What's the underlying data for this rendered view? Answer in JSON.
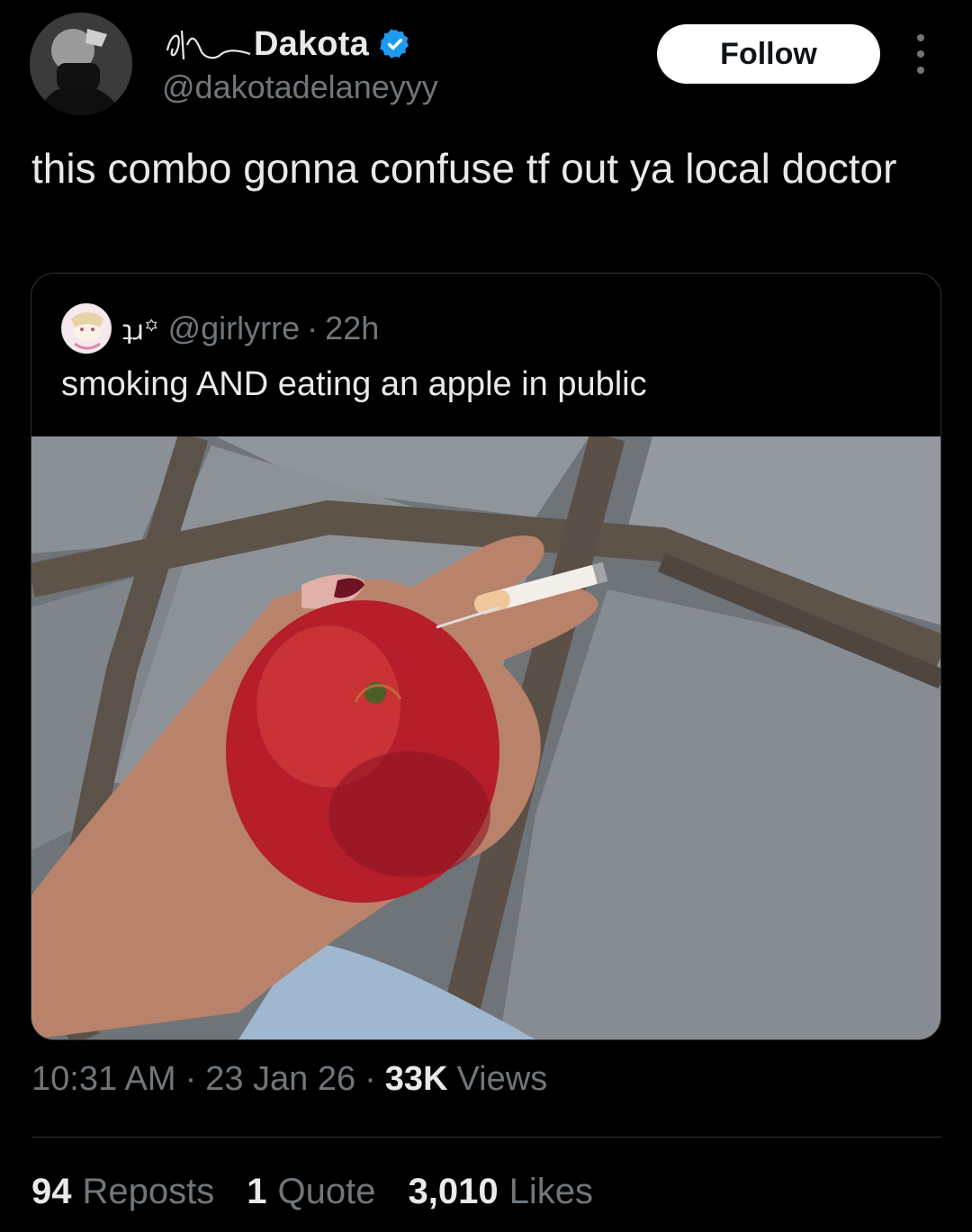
{
  "author": {
    "display_name": "Dakota",
    "handle": "@dakotadelaneyyy",
    "verified_icon": "verified-badge-icon",
    "accent_color": "#1d9bf0"
  },
  "follow_label": "Follow",
  "more_icon": "more-dots-icon",
  "tweet": {
    "text": "this combo gonna confuse tf out ya local doctor"
  },
  "quoted": {
    "glyph": "ʇɹ꙳",
    "handle": "@girlyrre",
    "separator": "·",
    "time": "22h",
    "text": "smoking AND eating an apple in public",
    "image": "photo of a hand holding a red apple and a cigarette over stone pavement"
  },
  "meta": {
    "time": "10:31 AM",
    "date": "23 Jan 26",
    "sep": "·",
    "views_count": "33K",
    "views_label": "Views"
  },
  "stats": [
    {
      "count": "94",
      "label": "Reposts"
    },
    {
      "count": "1",
      "label": "Quote"
    },
    {
      "count": "3,010",
      "label": "Likes"
    }
  ]
}
